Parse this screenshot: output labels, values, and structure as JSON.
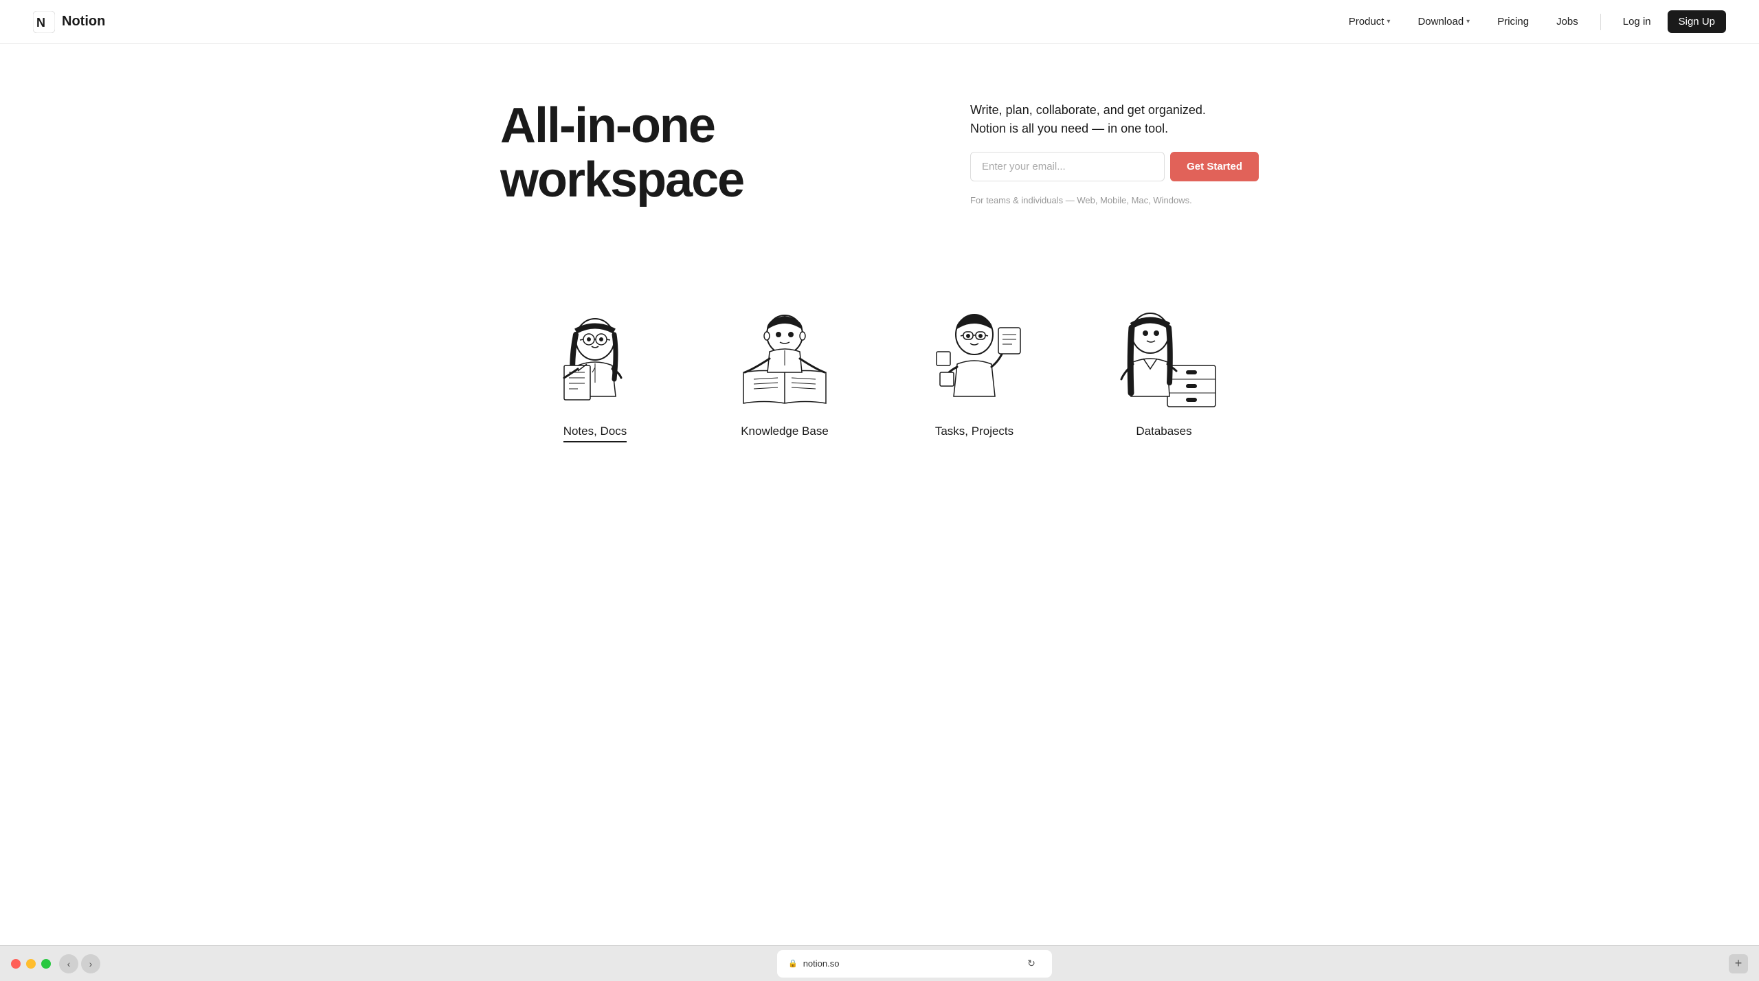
{
  "browser": {
    "url": "notion.so",
    "back_label": "‹",
    "forward_label": "›",
    "new_tab_label": "+"
  },
  "navbar": {
    "logo_text": "Notion",
    "nav_items": [
      {
        "label": "Product",
        "has_chevron": true,
        "id": "product"
      },
      {
        "label": "Download",
        "has_chevron": true,
        "id": "download"
      },
      {
        "label": "Pricing",
        "has_chevron": false,
        "id": "pricing"
      },
      {
        "label": "Jobs",
        "has_chevron": false,
        "id": "jobs"
      }
    ],
    "login_label": "Log in",
    "signup_label": "Sign Up"
  },
  "hero": {
    "title": "All-in-one workspace",
    "subtitle_line1": "Write, plan, collaborate, and get organized.",
    "subtitle_line2": "Notion is all you need — in one tool.",
    "email_placeholder": "Enter your email...",
    "cta_label": "Get Started",
    "caption": "For teams & individuals — Web, Mobile, Mac, Windows."
  },
  "features": [
    {
      "id": "notes-docs",
      "label": "Notes, Docs",
      "active": true
    },
    {
      "id": "knowledge-base",
      "label": "Knowledge Base",
      "active": false
    },
    {
      "id": "tasks-projects",
      "label": "Tasks, Projects",
      "active": false
    },
    {
      "id": "databases",
      "label": "Databases",
      "active": false
    }
  ],
  "colors": {
    "accent": "#e16259",
    "text_primary": "#1a1a1a",
    "text_muted": "#999999",
    "border": "#dddddd"
  }
}
